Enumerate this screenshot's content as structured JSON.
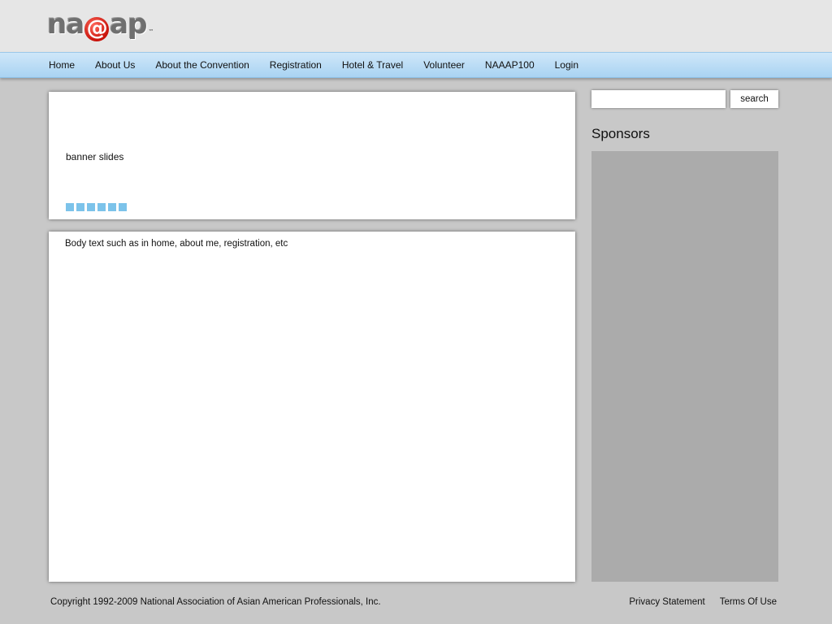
{
  "logo": {
    "left": "na",
    "at": "@",
    "right": "ap",
    "tm": "™"
  },
  "nav": {
    "items": [
      "Home",
      "About Us",
      "About the Convention",
      "Registration",
      "Hotel & Travel",
      "Volunteer",
      "NAAAP100",
      "Login"
    ]
  },
  "banner": {
    "label": "banner slides",
    "slide_count": 6
  },
  "body": {
    "text": "Body text such as in home, about me, registration, etc"
  },
  "search": {
    "value": "",
    "placeholder": "",
    "button_label": "search"
  },
  "sidebar": {
    "title": "Sponsors"
  },
  "footer": {
    "copyright": "Copyright 1992-2009 National Association of Asian American Professionals, Inc.",
    "links": [
      "Privacy Statement",
      "Terms Of Use"
    ]
  },
  "colors": {
    "nav_bg": "#b9ddf6",
    "slide_dot": "#7cc3ea",
    "logo_red": "#d4150c"
  }
}
